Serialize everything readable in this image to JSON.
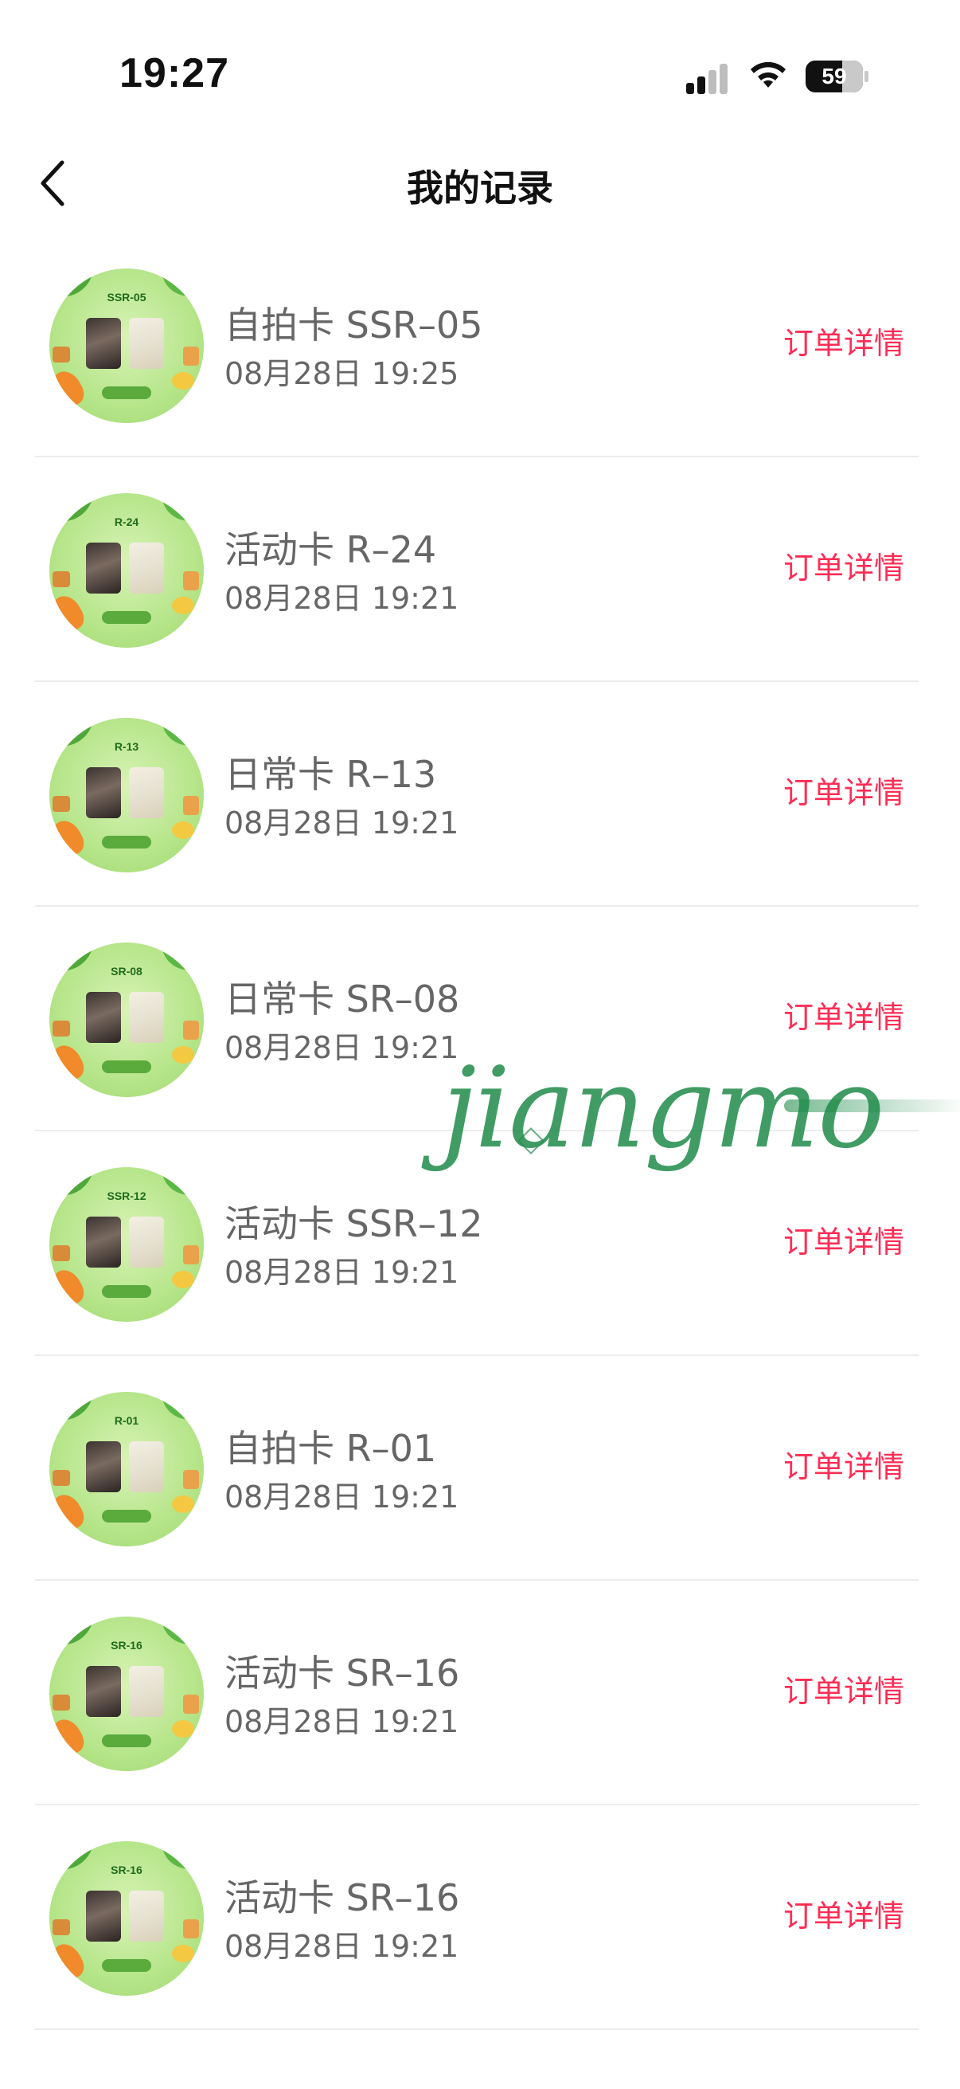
{
  "status_bar": {
    "time": "19:27",
    "battery": "59"
  },
  "nav": {
    "title": "我的记录",
    "back_icon": "chevron-left-icon"
  },
  "records": [
    {
      "code": "SSR-05",
      "title": "自拍卡 SSR–05",
      "date": "08月28日 19:25",
      "action": "订单详情"
    },
    {
      "code": "R-24",
      "title": "活动卡 R–24",
      "date": "08月28日 19:21",
      "action": "订单详情"
    },
    {
      "code": "R-13",
      "title": "日常卡 R–13",
      "date": "08月28日 19:21",
      "action": "订单详情"
    },
    {
      "code": "SR-08",
      "title": "日常卡 SR–08",
      "date": "08月28日 19:21",
      "action": "订单详情"
    },
    {
      "code": "SSR-12",
      "title": "活动卡 SSR–12",
      "date": "08月28日 19:21",
      "action": "订单详情"
    },
    {
      "code": "R-01",
      "title": "自拍卡 R–01",
      "date": "08月28日 19:21",
      "action": "订单详情"
    },
    {
      "code": "SR-16",
      "title": "活动卡 SR–16",
      "date": "08月28日 19:21",
      "action": "订单详情"
    },
    {
      "code": "SR-16",
      "title": "活动卡 SR–16",
      "date": "08月28日 19:21",
      "action": "订单详情"
    }
  ],
  "watermark": {
    "text": "jiangmo"
  },
  "colors": {
    "accent": "#ff2d55",
    "text_secondary": "#666666",
    "divider": "#ececec"
  }
}
